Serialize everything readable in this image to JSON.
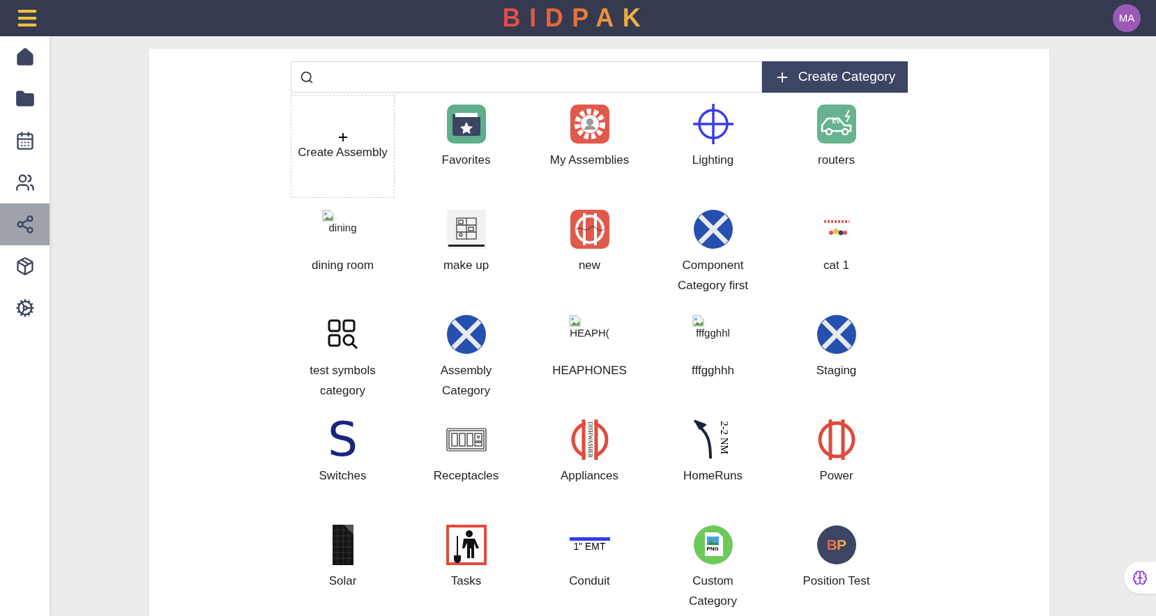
{
  "header": {
    "logo": "BIDPAK",
    "avatar": "MA"
  },
  "sidebar": {
    "items": [
      {
        "kind": "home",
        "selected": false
      },
      {
        "kind": "folder",
        "selected": false
      },
      {
        "kind": "calendar",
        "selected": false
      },
      {
        "kind": "people",
        "selected": false
      },
      {
        "kind": "nodes",
        "selected": true
      },
      {
        "kind": "box",
        "selected": false
      },
      {
        "kind": "gears",
        "selected": false
      }
    ]
  },
  "search": {
    "button": "Create Category"
  },
  "tiles": [
    {
      "kind": "create",
      "label": "Create Assembly"
    },
    {
      "kind": "folder-star",
      "label": "Favorites"
    },
    {
      "kind": "gear-person",
      "label": "My Assemblies"
    },
    {
      "kind": "crosshair",
      "label": "Lighting"
    },
    {
      "kind": "ev-car",
      "label": "routers",
      "icon_text": "EV"
    },
    {
      "kind": "broken",
      "label": "dining room",
      "icon_text": "dining"
    },
    {
      "kind": "shelves",
      "label": "make up"
    },
    {
      "kind": "red-bars-square",
      "label": "new"
    },
    {
      "kind": "blue-x",
      "label": "Component Category first"
    },
    {
      "kind": "mini-logo",
      "label": "cat 1"
    },
    {
      "kind": "grid-search",
      "label": "test symbols category"
    },
    {
      "kind": "blue-x",
      "label": "Assembly Category"
    },
    {
      "kind": "broken",
      "label": "HEAPHONES",
      "icon_text": "HEAPH("
    },
    {
      "kind": "broken",
      "label": "fffgghhh",
      "icon_text": "fffgghhl"
    },
    {
      "kind": "blue-x",
      "label": "Staging"
    },
    {
      "kind": "letter",
      "label": "Switches",
      "icon_text": "S"
    },
    {
      "kind": "receptacle",
      "label": "Receptacles"
    },
    {
      "kind": "red-bars-text",
      "label": "Appliances",
      "icon_text": "DISHWASHER"
    },
    {
      "kind": "arrow-text",
      "label": "HomeRuns",
      "icon_text": "2-2 NM"
    },
    {
      "kind": "red-bars",
      "label": "Power"
    },
    {
      "kind": "solar",
      "label": "Solar"
    },
    {
      "kind": "worker",
      "label": "Tasks"
    },
    {
      "kind": "bar-text",
      "label": "Conduit",
      "icon_text": "1\" EMT"
    },
    {
      "kind": "png",
      "label": "Custom Category",
      "icon_text": "PNG"
    },
    {
      "kind": "badge",
      "label": "Position Test",
      "icon_text": "BP"
    }
  ]
}
